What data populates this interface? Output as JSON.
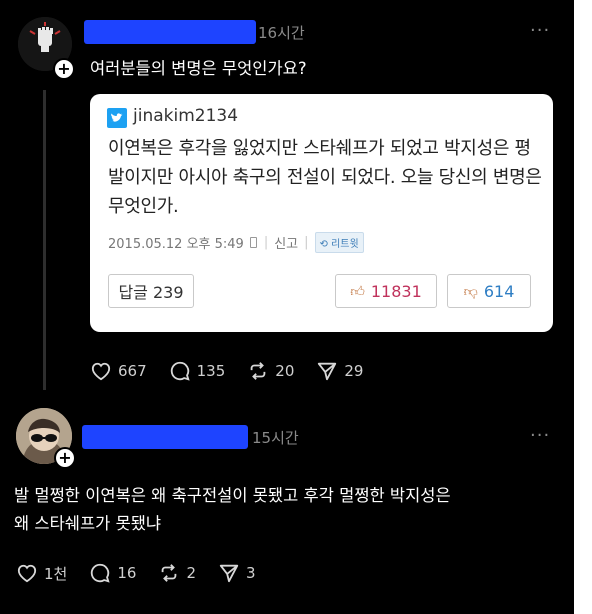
{
  "post1": {
    "time": "16시간",
    "more": "···",
    "text": "여러분들의 변명은 무엇인가요?",
    "tweet": {
      "username": "jinakim2134",
      "body": "이연복은 후각을 잃었지만 스타쉐프가 되었고 박지성은 평발이지만 아시아 축구의 전설이 되었다. 오늘 당신의 변명은 무엇인가.",
      "date": "2015.05.12 오후 5:49",
      "report": "신고",
      "retweet": "리트윗",
      "reply_label": "답글 239",
      "like_count": "11831",
      "dislike_count": "614"
    },
    "likes": "667",
    "comments": "135",
    "reposts": "20",
    "shares": "29"
  },
  "post2": {
    "time": "15시간",
    "more": "···",
    "text_line1": "발 멀쩡한 이연복은 왜 축구전설이 못됐고 후각 멀쩡한 박지성은",
    "text_line2": "왜 스타쉐프가 못됐냐",
    "likes": "1천",
    "comments": "16",
    "reposts": "2",
    "shares": "3"
  },
  "colors": {
    "background": "#000000",
    "text": "#ffffff",
    "muted": "#8a8a8a",
    "redaction": "#1e44ff"
  }
}
